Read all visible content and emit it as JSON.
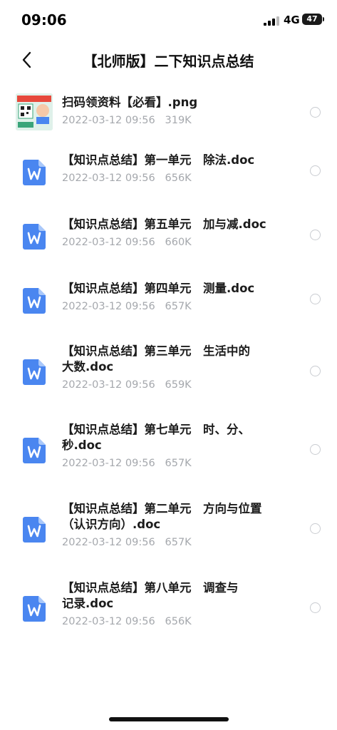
{
  "status": {
    "time": "09:06",
    "network": "4G",
    "battery": "47"
  },
  "header": {
    "back_icon": "chevron-left-icon",
    "title": "【北师版】二下知识点总结"
  },
  "files": [
    {
      "type": "image",
      "name": "扫码领资料【必看】.png",
      "date": "2022-03-12 09:56",
      "size": "319K"
    },
    {
      "type": "doc",
      "name": "【知识点总结】第一单元　除法.doc",
      "date": "2022-03-12 09:56",
      "size": "656K"
    },
    {
      "type": "doc",
      "name": "【知识点总结】第五单元　加与减.doc",
      "date": "2022-03-12 09:56",
      "size": "660K"
    },
    {
      "type": "doc",
      "name": "【知识点总结】第四单元　测量.doc",
      "date": "2022-03-12 09:56",
      "size": "657K"
    },
    {
      "type": "doc",
      "name": "【知识点总结】第三单元　生活中的\n大数.doc",
      "date": "2022-03-12 09:56",
      "size": "659K"
    },
    {
      "type": "doc",
      "name": "【知识点总结】第七单元　时、分、\n秒.doc",
      "date": "2022-03-12 09:56",
      "size": "657K"
    },
    {
      "type": "doc",
      "name": "【知识点总结】第二单元　方向与位置\n（认识方向）.doc",
      "date": "2022-03-12 09:56",
      "size": "657K"
    },
    {
      "type": "doc",
      "name": "【知识点总结】第八单元　调查与\n记录.doc",
      "date": "2022-03-12 09:56",
      "size": "656K"
    }
  ],
  "colors": {
    "doc_icon": "#4a86f0",
    "meta_text": "#a5a8ad",
    "title_text": "#1c1c1c"
  }
}
